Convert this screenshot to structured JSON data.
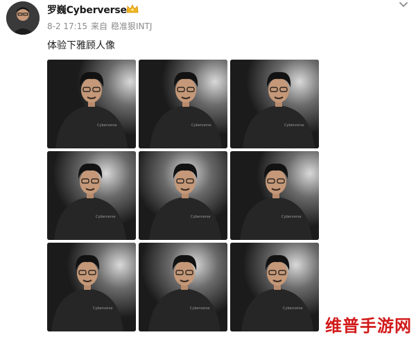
{
  "post": {
    "author_name": "罗巍Cyberverse",
    "date": "8-2 17:15",
    "source_prefix": "来自",
    "source_name": "稳准狠INTJ",
    "text": "体验下雅顾人像"
  },
  "icons": {
    "crown": "crown-badge-icon",
    "more": "chevron-down-icon"
  },
  "photos": [
    {
      "label": "photo-1",
      "shirt_logo": "Cyberverse"
    },
    {
      "label": "photo-2",
      "shirt_logo": "Cyberverse"
    },
    {
      "label": "photo-3",
      "shirt_logo": "Cyberverse"
    },
    {
      "label": "photo-4",
      "shirt_logo": "Cyberverse"
    },
    {
      "label": "photo-5",
      "shirt_logo": "Cyberverse"
    },
    {
      "label": "photo-6",
      "shirt_logo": "Cyberverse"
    },
    {
      "label": "photo-7",
      "shirt_logo": "Cyberverse"
    },
    {
      "label": "photo-8",
      "shirt_logo": "Cyberverse"
    },
    {
      "label": "photo-9",
      "shirt_logo": "Cyberverse"
    }
  ],
  "watermark": "维普手游网",
  "colors": {
    "text": "#1a1a1a",
    "meta": "#8a8a8a",
    "watermark": "#d21919"
  }
}
